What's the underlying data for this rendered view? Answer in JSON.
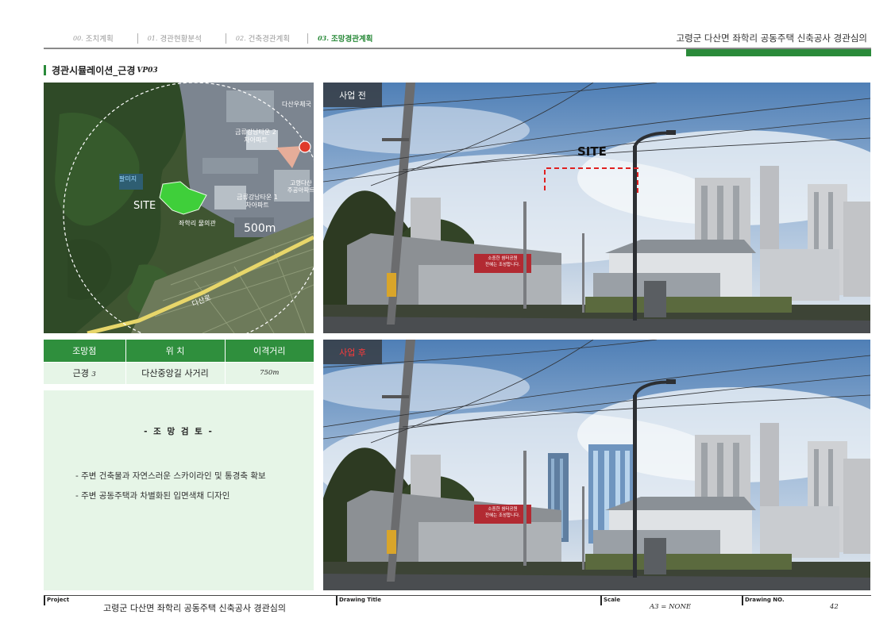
{
  "header": {
    "nav": [
      {
        "num": "00.",
        "label": "조치계획"
      },
      {
        "num": "01.",
        "label": "경관현황분석"
      },
      {
        "num": "02.",
        "label": "건축경관계획"
      },
      {
        "num": "03.",
        "label": "조망경관계획"
      }
    ],
    "doc_title": "고령군 다산면 좌학리 공동주택 신축공사 경관심의"
  },
  "section": {
    "title": "경관시뮬레이션_근경",
    "code": "VP03"
  },
  "map": {
    "labels": {
      "site": "SITE",
      "radius": "500m",
      "road": "다산로",
      "places": [
        "다산우체국",
        "금류강남타운 2차아파트",
        "금류강남타운 1차아파트",
        "고령다산 주공아파트",
        "좌학리 물의관",
        "팔미지"
      ]
    }
  },
  "table": {
    "headers": [
      "조망점",
      "위  치",
      "이격거리"
    ],
    "row": {
      "point": "근경",
      "point_num": "3",
      "location": "다산중앙길 사거리",
      "distance": "750m"
    }
  },
  "review": {
    "title": "- 조 망 검 토 -",
    "items": [
      "- 주변 건축물과 자연스러운 스카이라인 및 통경축 확보",
      "- 주변 공동주택과 차별화된 입면색채 디자인"
    ]
  },
  "photos": {
    "before": {
      "label": "사업 전",
      "site_label": "SITE",
      "sign_text": [
        "소중한 쉼터공원",
        "잔혜는 조성합니다."
      ]
    },
    "after": {
      "label": "사업 후",
      "sign_text": [
        "소중한 쉼터공원",
        "잔혜는 조성합니다."
      ]
    }
  },
  "footer": {
    "project_label": "Project",
    "project_value": "고령군 다산면 좌학리 공동주택 신축공사 경관심의",
    "drawing_title_label": "Drawing Title",
    "drawing_title_value": "",
    "scale_label": "Scale",
    "scale_value": "A3 = NONE",
    "drawing_no_label": "Drawing NO.",
    "drawing_no_value": "42"
  },
  "colors": {
    "accent": "#2a8a3a",
    "table_head": "#2f8f3d",
    "panel_bg": "#e6f5e7",
    "site_marker": "#e03a2a"
  }
}
